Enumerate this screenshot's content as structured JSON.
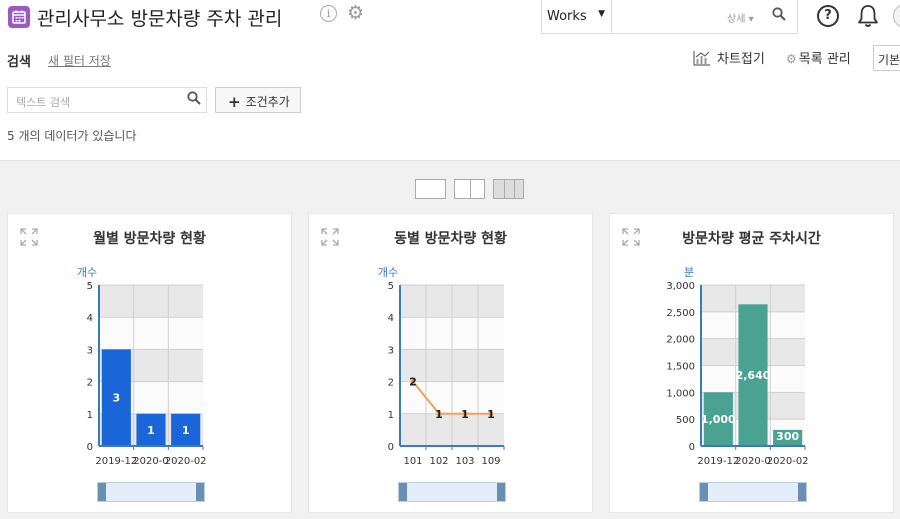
{
  "header": {
    "title": "관리사무소 방문차량 주차 관리",
    "app_icon": "calendar-icon",
    "search_scope": "Works",
    "search_detail": "상세",
    "accent_color": "#9b59c4"
  },
  "toolbar": {
    "search_label": "검색",
    "save_filter": "새 필터 저장",
    "chart_fold": "차트접기",
    "list_manage": "목록 관리",
    "basic_view": "기본"
  },
  "filters": {
    "text_search_placeholder": "텍스트 검색",
    "add_condition": "조건추가",
    "count_text": "5 개의 데이터가 있습니다"
  },
  "chart_data": [
    {
      "type": "bar",
      "title": "월별 방문차량 현황",
      "ylabel": "개수",
      "categories": [
        "2019-12",
        "2020-01",
        "2020-02"
      ],
      "tick_labels": [
        "2019-12",
        "2020-0",
        "2020-02"
      ],
      "values": [
        3,
        1,
        1
      ],
      "value_labels": [
        "3",
        "1",
        "1"
      ],
      "ylim": [
        0,
        5
      ],
      "yticks": [
        "0",
        "1",
        "2",
        "3",
        "4",
        "5"
      ],
      "color": "#1a66d8",
      "grid": true
    },
    {
      "type": "line",
      "title": "동별 방문차량 현황",
      "ylabel": "개수",
      "categories": [
        "101",
        "102",
        "103",
        "109"
      ],
      "tick_labels": [
        "101",
        "102",
        "103",
        "109"
      ],
      "values": [
        2,
        1,
        1,
        1
      ],
      "value_labels": [
        "2",
        "1",
        "1",
        "1"
      ],
      "ylim": [
        0,
        5
      ],
      "yticks": [
        "0",
        "1",
        "2",
        "3",
        "4",
        "5"
      ],
      "color": "#f2a05c",
      "grid": true
    },
    {
      "type": "bar",
      "title": "방문차량 평균 주차시간",
      "ylabel": "분",
      "categories": [
        "2019-12",
        "2020-01",
        "2020-02"
      ],
      "tick_labels": [
        "2019-12",
        "2020-0",
        "2020-02"
      ],
      "values": [
        1000,
        2640,
        300
      ],
      "value_labels": [
        "1,000",
        "2,640",
        "300"
      ],
      "ylim": [
        0,
        3000
      ],
      "yticks": [
        "0",
        "500",
        "1,000",
        "1,500",
        "2,000",
        "2,500",
        "3,000"
      ],
      "color": "#4aa293",
      "grid": true
    }
  ]
}
